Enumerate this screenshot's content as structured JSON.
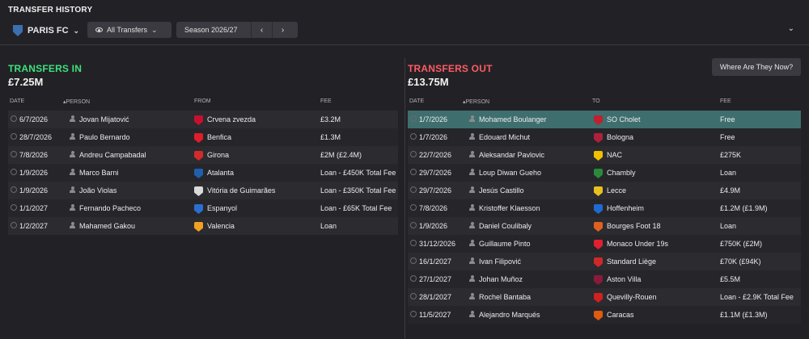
{
  "header": {
    "title": "TRANSFER HISTORY",
    "club": "PARIS FC",
    "filter": "All Transfers",
    "season": "Season 2026/27",
    "prev_icon": "chevron-left-icon",
    "next_icon": "chevron-right-icon"
  },
  "transfers_in": {
    "heading": "TRANSFERS IN",
    "total": "£7.25M",
    "columns": [
      "DATE",
      "PERSON",
      "FROM",
      "FEE"
    ],
    "rows": [
      {
        "date": "6/7/2026",
        "person": "Jovan Mijatović",
        "club": "Crvena zvezda",
        "fee": "£3.2M",
        "crest": "#c8102e"
      },
      {
        "date": "28/7/2026",
        "person": "Paulo Bernardo",
        "club": "Benfica",
        "fee": "£1.3M",
        "crest": "#e21c2a"
      },
      {
        "date": "7/8/2026",
        "person": "Andreu Campabadal",
        "club": "Girona",
        "fee": "£2M (£2.4M)",
        "crest": "#d42a2a"
      },
      {
        "date": "1/9/2026",
        "person": "Marco Barni",
        "club": "Atalanta",
        "fee": "Loan - £450K Total Fee",
        "crest": "#1f5fb0"
      },
      {
        "date": "1/9/2026",
        "person": "João Violas",
        "club": "Vitória de Guimarães",
        "fee": "Loan - £350K Total Fee",
        "crest": "#dadada"
      },
      {
        "date": "1/1/2027",
        "person": "Fernando Pacheco",
        "club": "Espanyol",
        "fee": "Loan - £65K Total Fee",
        "crest": "#2a6fd0"
      },
      {
        "date": "1/2/2027",
        "person": "Mahamed Gakou",
        "club": "Valencia",
        "fee": "Loan",
        "crest": "#f0a020"
      }
    ]
  },
  "transfers_out": {
    "heading": "TRANSFERS OUT",
    "total": "£13.75M",
    "where_button": "Where Are They Now?",
    "columns": [
      "DATE",
      "PERSON",
      "TO",
      "FEE"
    ],
    "rows": [
      {
        "date": "1/7/2026",
        "person": "Mohamed Boulanger",
        "club": "SO Cholet",
        "fee": "Free",
        "crest": "#c02030",
        "selected": true
      },
      {
        "date": "1/7/2026",
        "person": "Edouard Michut",
        "club": "Bologna",
        "fee": "Free",
        "crest": "#b0203a"
      },
      {
        "date": "22/7/2026",
        "person": "Aleksandar Pavlovic",
        "club": "NAC",
        "fee": "£275K",
        "crest": "#f0c000"
      },
      {
        "date": "29/7/2026",
        "person": "Loup Diwan Gueho",
        "club": "Chambly",
        "fee": "Loan",
        "crest": "#2a8a3a"
      },
      {
        "date": "29/7/2026",
        "person": "Jesús Castillo",
        "club": "Lecce",
        "fee": "£4.9M",
        "crest": "#e6c020"
      },
      {
        "date": "7/8/2026",
        "person": "Kristoffer Klaesson",
        "club": "Hoffenheim",
        "fee": "£1.2M (£1.9M)",
        "crest": "#1f6ad0"
      },
      {
        "date": "1/9/2026",
        "person": "Daniel Coulibaly",
        "club": "Bourges Foot 18",
        "fee": "Loan",
        "crest": "#e06020"
      },
      {
        "date": "31/12/2026",
        "person": "Guillaume Pinto",
        "club": "Monaco Under 19s",
        "fee": "£750K (£2M)",
        "crest": "#e02030"
      },
      {
        "date": "16/1/2027",
        "person": "Ivan Filipović",
        "club": "Standard Liège",
        "fee": "£70K (£94K)",
        "crest": "#d02828"
      },
      {
        "date": "27/1/2027",
        "person": "Johan Muñoz",
        "club": "Aston Villa",
        "fee": "£5.5M",
        "crest": "#8a1a3a"
      },
      {
        "date": "28/1/2027",
        "person": "Rochel Bantaba",
        "club": "Quevilly-Rouen",
        "fee": "Loan - £2.9K Total Fee",
        "crest": "#d02020"
      },
      {
        "date": "11/5/2027",
        "person": "Alejandro Marqués",
        "club": "Caracas",
        "fee": "£1.1M (£1.3M)",
        "crest": "#e05a10"
      }
    ]
  }
}
